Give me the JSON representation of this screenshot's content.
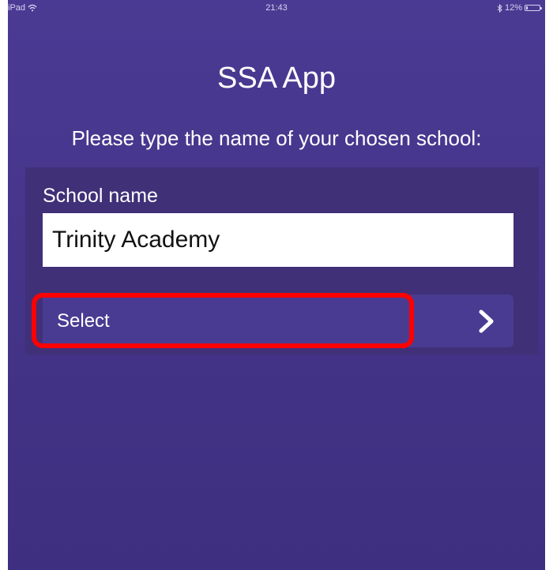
{
  "status_bar": {
    "device": "iPad",
    "wifi_icon": "wifi-icon",
    "time": "21:43",
    "bluetooth_icon": "bluetooth-icon",
    "battery_percent": "12%",
    "battery_level": 0.12
  },
  "header": {
    "title": "SSA App"
  },
  "form": {
    "prompt": "Please type the name of your chosen school:",
    "field_label": "School name",
    "field_value": "Trinity Academy",
    "select_label": "Select",
    "chevron_icon": "chevron-right-icon"
  },
  "annotation": {
    "highlight_color": "#ff0000"
  },
  "colors": {
    "background": "#45358a",
    "panel": "#3f3078",
    "button": "#4a3b92"
  }
}
